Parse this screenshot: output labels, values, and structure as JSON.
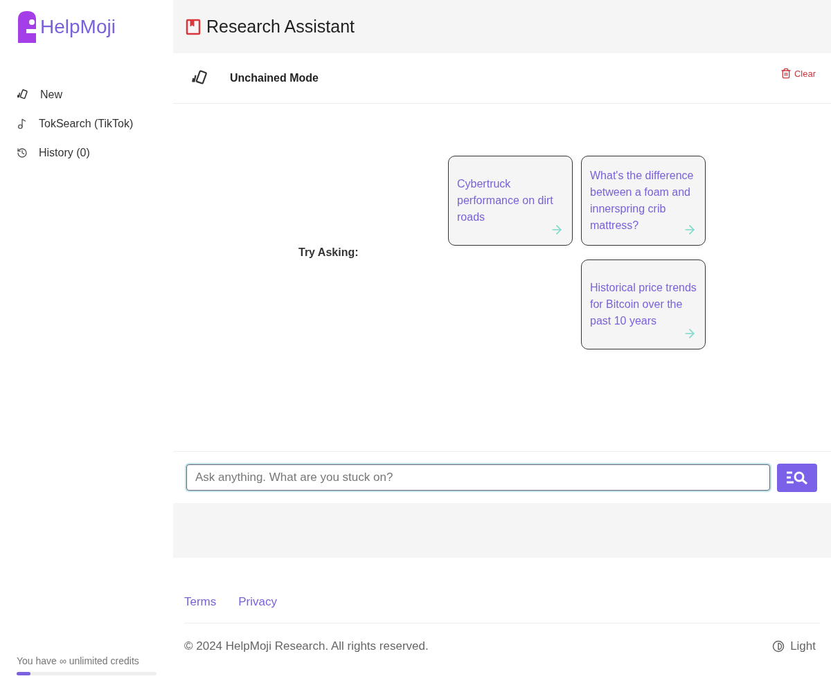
{
  "logo": {
    "text": "HelpMoji"
  },
  "sidebar": {
    "items": [
      {
        "kind": "new",
        "label": "New"
      },
      {
        "kind": "tiktok",
        "label": "TokSearch (TikTok)"
      },
      {
        "kind": "history",
        "label": "History (0)"
      }
    ],
    "credits": {
      "text": "You have ∞ unlimited credits",
      "level": 0.1
    }
  },
  "header": {
    "title": "Research Assistant"
  },
  "chat": {
    "mode": "Unchained Mode",
    "clear": "Clear",
    "try_label": "Try Asking:",
    "suggestion_columns": [
      [
        "Cybertruck performance on dirt roads"
      ],
      [
        "What's the difference between a foam and innerspring crib mattress?",
        "Historical price trends for Bitcoin over the past 10 years"
      ]
    ],
    "input": {
      "placeholder": "Ask anything. What are you stuck on?"
    }
  },
  "footer": {
    "links": [
      "Terms",
      "Privacy"
    ],
    "copyright": "© 2024 HelpMoji Research. All rights reserved.",
    "theme": "Light"
  }
}
